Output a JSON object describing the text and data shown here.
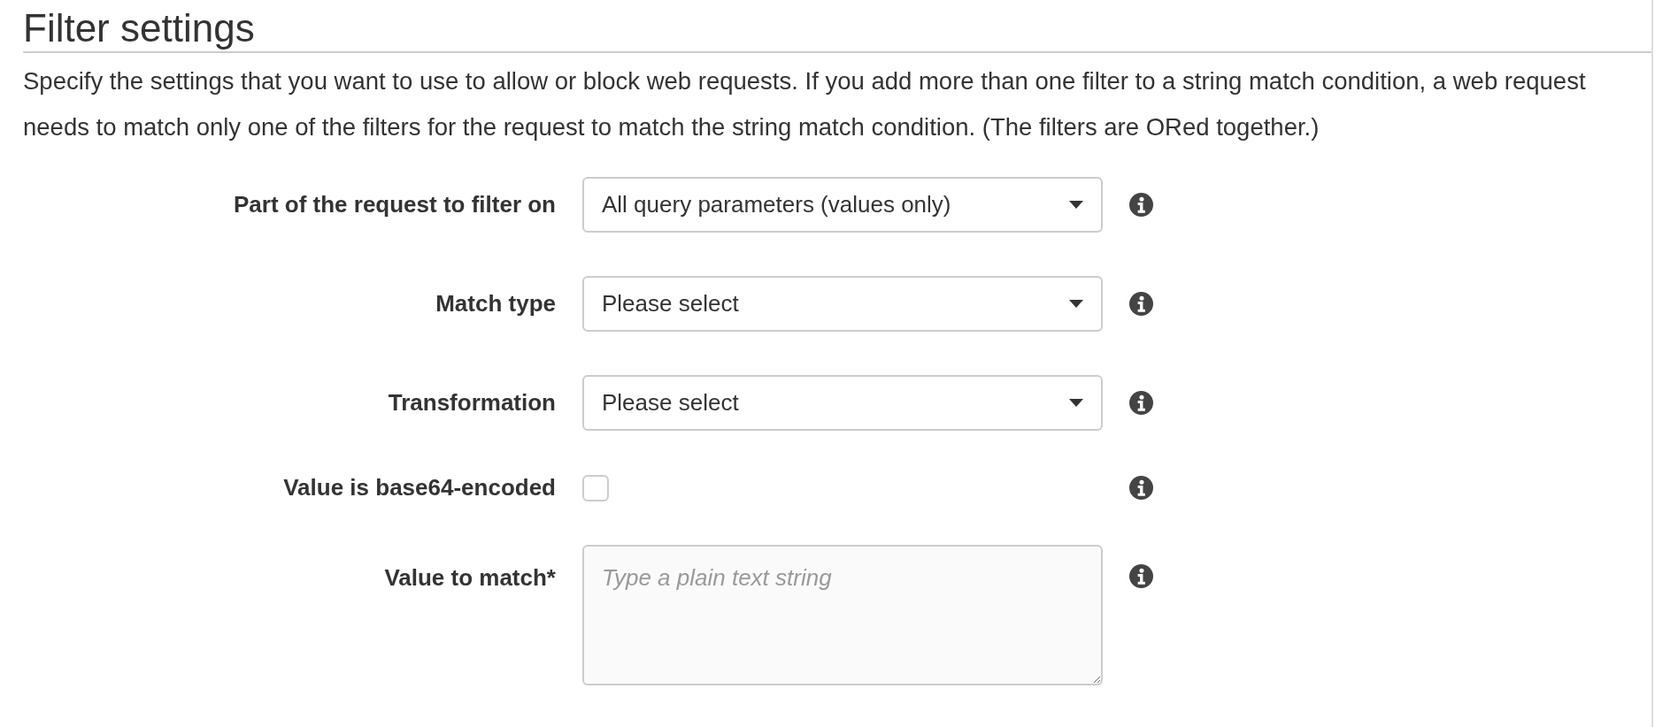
{
  "section": {
    "title": "Filter settings",
    "description": "Specify the settings that you want to use to allow or block web requests. If you add more than one filter to a string match condition, a web request needs to match only one of the filters for the request to match the string match condition. (The filters are ORed together.)"
  },
  "fields": [
    {
      "kind": "select",
      "label": "Part of the request to filter on",
      "value": "All query parameters (values only)"
    },
    {
      "kind": "select",
      "label": "Match type",
      "value": "Please select"
    },
    {
      "kind": "select",
      "label": "Transformation",
      "value": "Please select"
    },
    {
      "kind": "checkbox",
      "label": "Value is base64-encoded",
      "checked": false
    },
    {
      "kind": "textarea",
      "label": "Value to match*",
      "placeholder": "Type a plain text string"
    }
  ]
}
